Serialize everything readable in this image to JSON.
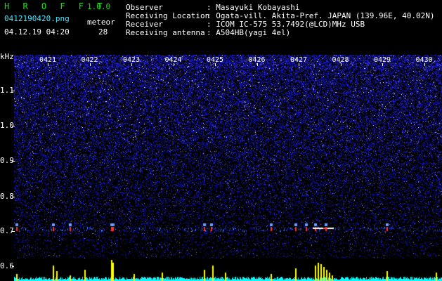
{
  "header": {
    "app_name": "H R O F F T",
    "version": "1.0.0",
    "filename": "0412190420.png",
    "datetime": "04.12.19 04:20",
    "meteor_label": "meteor",
    "meteor_count": "28",
    "info": [
      {
        "label": "Observer",
        "value": ": Masayuki Kobayashi"
      },
      {
        "label": "Receiving Location",
        "value": ": Ogata-vill. Akita-Pref. JAPAN (139.96E, 40.02N)"
      },
      {
        "label": "Receiver",
        "value": ": ICOM IC-575 53.7492(@LCD)MHz USB"
      },
      {
        "label": "Receiving antenna",
        "value": ": A504HB(yagi 4el)"
      }
    ]
  },
  "axis": {
    "unit": "kHz",
    "y_labels": [
      "1.1",
      "1.0",
      "0.9",
      "0.8",
      "0.7",
      "0.6"
    ],
    "time_labels": [
      "0421",
      "0422",
      "0423",
      "0424",
      "0425",
      "0426",
      "0427",
      "0428",
      "0429",
      "0430"
    ]
  },
  "colors": {
    "background": "#000000",
    "noise": "#1a1adc",
    "header_green": "#18e018",
    "header_cyan": "#46e6ff",
    "count_bars": "#ffff00",
    "count_base": "#00ffff"
  }
}
